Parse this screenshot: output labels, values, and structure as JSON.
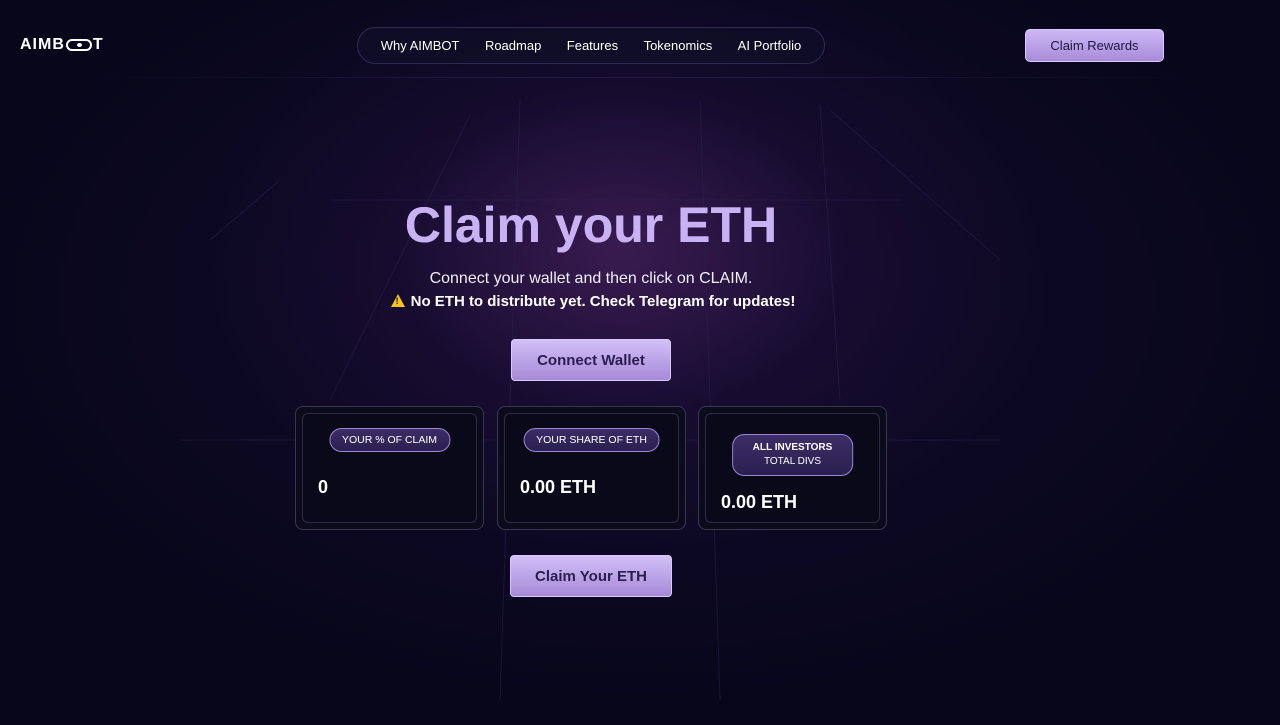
{
  "header": {
    "logo": "AIMB○T",
    "logo_left": "AIMB",
    "logo_right": "T",
    "nav": [
      "Why AIMBOT",
      "Roadmap",
      "Features",
      "Tokenomics",
      "AI Portfolio"
    ],
    "claim_rewards": "Claim Rewards"
  },
  "hero": {
    "title": "Claim your ETH",
    "subtitle": "Connect your wallet and then click on CLAIM.",
    "warning_icon": "warning-icon",
    "warning": "No ETH to distribute yet. Check Telegram for updates!",
    "connect_button": "Connect Wallet"
  },
  "stats": [
    {
      "label": "YOUR % OF CLAIM",
      "value": "0"
    },
    {
      "label": "YOUR SHARE OF ETH",
      "value": "0.00 ETH"
    },
    {
      "label_line1": "ALL INVESTORS",
      "label_line2": "TOTAL DIVS",
      "value": "0.00 ETH"
    }
  ],
  "claim_button": "Claim Your ETH",
  "colors": {
    "background": "#07061a",
    "accent": "#c9b2f3",
    "button": "#b89de6",
    "warning": "#f5c518"
  }
}
